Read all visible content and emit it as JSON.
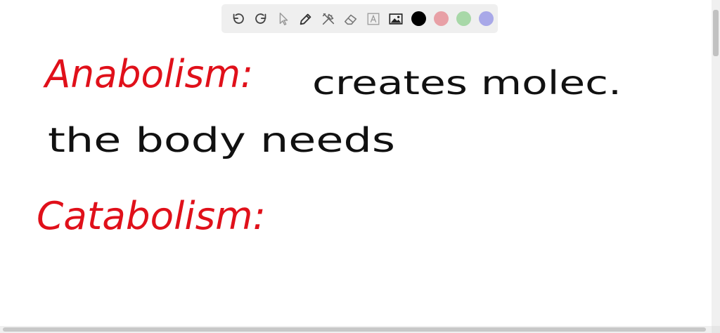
{
  "toolbar": {
    "tools": [
      {
        "name": "undo-icon"
      },
      {
        "name": "redo-icon"
      },
      {
        "name": "pointer-icon"
      },
      {
        "name": "pen-icon"
      },
      {
        "name": "tools-icon"
      },
      {
        "name": "eraser-icon"
      },
      {
        "name": "text-icon"
      },
      {
        "name": "image-icon"
      }
    ],
    "colors": {
      "black": "#000000",
      "red": "#e8a0a6",
      "green": "#a8d8a8",
      "blue": "#a8a8e8"
    },
    "selected_color": "black",
    "background": "#efefef"
  },
  "notes": {
    "lines": [
      {
        "text": "Anabolism:",
        "color": "#e0101a"
      },
      {
        "text": "creates molec.",
        "color": "#111111"
      },
      {
        "text": "the body needs",
        "color": "#111111"
      },
      {
        "text": "Catabolism:",
        "color": "#e0101a"
      }
    ]
  }
}
